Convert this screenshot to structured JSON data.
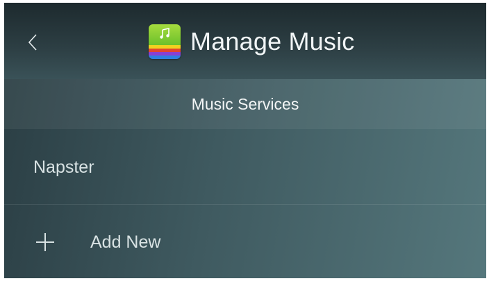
{
  "header": {
    "back_icon": "chevron-left-icon",
    "app_icon": "music-app-icon",
    "title": "Manage Music"
  },
  "section": {
    "title": "Music Services"
  },
  "services": [
    {
      "label": "Napster"
    }
  ],
  "add_new": {
    "icon": "plus-icon",
    "label": "Add New"
  },
  "colors": {
    "header_dark": "#1d2a2e",
    "body_gradient_start": "#2a3d43",
    "body_gradient_end": "#55777c",
    "text": "#f1f5f6"
  }
}
